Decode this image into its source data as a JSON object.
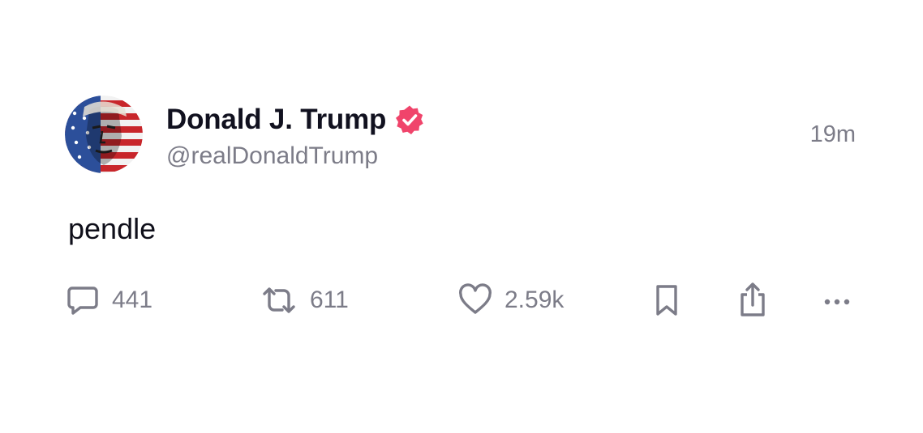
{
  "post": {
    "author": {
      "display_name": "Donald J. Trump",
      "handle": "@realDonaldTrump",
      "verified": true,
      "verified_color": "#f0446b"
    },
    "timestamp": "19m",
    "text": "pendle",
    "actions": {
      "reply": {
        "icon": "reply-bubble-icon",
        "count": "441"
      },
      "repost": {
        "icon": "repost-icon",
        "count": "611"
      },
      "like": {
        "icon": "heart-icon",
        "count": "2.59k"
      },
      "bookmark": {
        "icon": "bookmark-icon"
      },
      "share": {
        "icon": "share-icon"
      },
      "more": {
        "icon": "more-dots-icon"
      }
    }
  },
  "colors": {
    "text_primary": "#11111f",
    "text_secondary": "#7c7c88",
    "accent": "#f0446b",
    "background": "#ffffff"
  }
}
